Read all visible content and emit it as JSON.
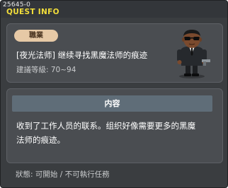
{
  "window": {
    "quest_id": "25645-0",
    "title": "QUEST INFO"
  },
  "quest": {
    "job_badge": "職業",
    "name": "[夜光法师] 继续寻找黑魔法师的痕迹",
    "level": "建議等級: 70~94",
    "npc_icon": "npc-agent-in-black-suit-with-gun"
  },
  "content": {
    "header": "内容",
    "line1": "收到了工作人员的联系。组织好像需要更多的黑魔",
    "line2": "法师的痕迹。"
  },
  "status": "狀態: 可開始 / 不可執行任務",
  "colors": {
    "title": "#f2de3a",
    "background": "#3a3d40",
    "badge": "#e6c9a6",
    "content_header": "#5f6d78"
  }
}
